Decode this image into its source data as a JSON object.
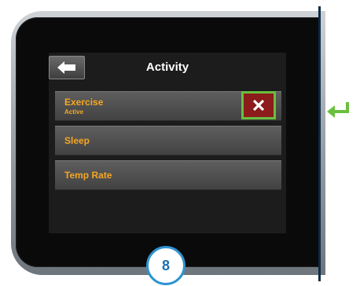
{
  "screen": {
    "title": "Activity",
    "back_button_icon": "arrow-left-icon"
  },
  "menu": [
    {
      "label": "Exercise",
      "sub": "Active"
    },
    {
      "label": "Sleep"
    },
    {
      "label": "Temp Rate"
    }
  ],
  "cancel_button_icon": "close-icon",
  "enter_icon": "enter-return-icon",
  "step_badge": "8",
  "colors": {
    "accent_text": "#f5a623",
    "cancel_bg": "#8c1b1b",
    "highlight_green": "#6abf3e",
    "badge_blue": "#2e93d1"
  }
}
